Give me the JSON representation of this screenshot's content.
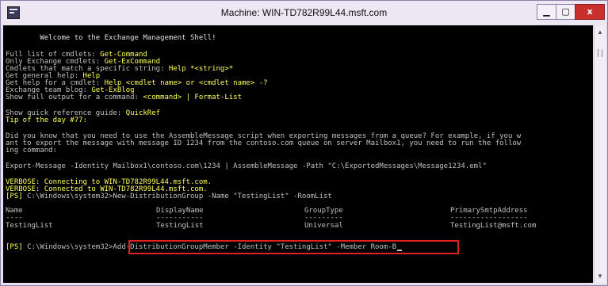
{
  "window": {
    "title": "Machine: WIN-TD782R99L44.msft.com",
    "controls": {
      "minimize": "▁",
      "maximize": "▢",
      "close": "x"
    }
  },
  "console": {
    "welcome": "        Welcome to the Exchange Management Shell!",
    "help": [
      {
        "text": "Full list of cmdlets: ",
        "cmd": "Get-Command"
      },
      {
        "text": "Only Exchange cmdlets: ",
        "cmd": "Get-ExCommand"
      },
      {
        "text": "Cmdlets that match a specific string: ",
        "cmd": "Help *<string>*"
      },
      {
        "text": "Get general help: ",
        "cmd": "Help"
      },
      {
        "text": "Get help for a cmdlet: ",
        "cmd": "Help <cmdlet name> or <cmdlet name> -?"
      },
      {
        "text": "Exchange team blog: ",
        "cmd": "Get-ExBlog"
      },
      {
        "text": "Show full output for a command: ",
        "cmd": "<command> | Format-List"
      }
    ],
    "quickref": {
      "text": "Show quick reference guide: ",
      "cmd": "QuickRef"
    },
    "tip_title": "Tip of the day #77:",
    "tip_lines": [
      "Did you know that you need to use the AssembleMessage script when exporting messages from a queue? For example, if you w",
      "ant to export the message with message ID 1234 from the contoso.com queue on server Mailbox1, you need to run the follow",
      "ing command:"
    ],
    "export_cmd": "Export-Message -Identity Mailbox1\\contoso.com\\1234 | AssembleMessage -Path \"C:\\ExportedMessages\\Message1234.eml\"",
    "verbose_lines": [
      "VERBOSE: Connecting to WIN-TD782R99L44.msft.com.",
      "VERBOSE: Connected to WIN-TD782R99L44.msft.com."
    ],
    "prompt1": {
      "ps": "[PS]",
      "path": " C:\\Windows\\system32>",
      "cmd": "New-DistributionGroup -Name \"TestingList\" -RoomList"
    },
    "table": {
      "headers": [
        "Name",
        "DisplayName",
        "GroupType",
        "PrimarySmtpAddress"
      ],
      "underlines": [
        "----",
        "-----------",
        "---------",
        "------------------"
      ],
      "rows": [
        [
          "TestingList",
          "TestingList",
          "Universal",
          "TestingList@msft.com"
        ]
      ]
    },
    "prompt2": {
      "ps": "[PS]",
      "path": " C:\\Windows\\system32>",
      "cmd": "Add-DistributionGroupMember -Identity \"TestingList\" -Member Room-B"
    }
  },
  "scrollbar": {
    "up": "▲",
    "down": "▼"
  },
  "colors": {
    "console_bg": "#000000",
    "highlight": "#ffff55",
    "text": "#c0c0c0",
    "annotation_box": "#e02020",
    "close_button": "#c9302c"
  }
}
